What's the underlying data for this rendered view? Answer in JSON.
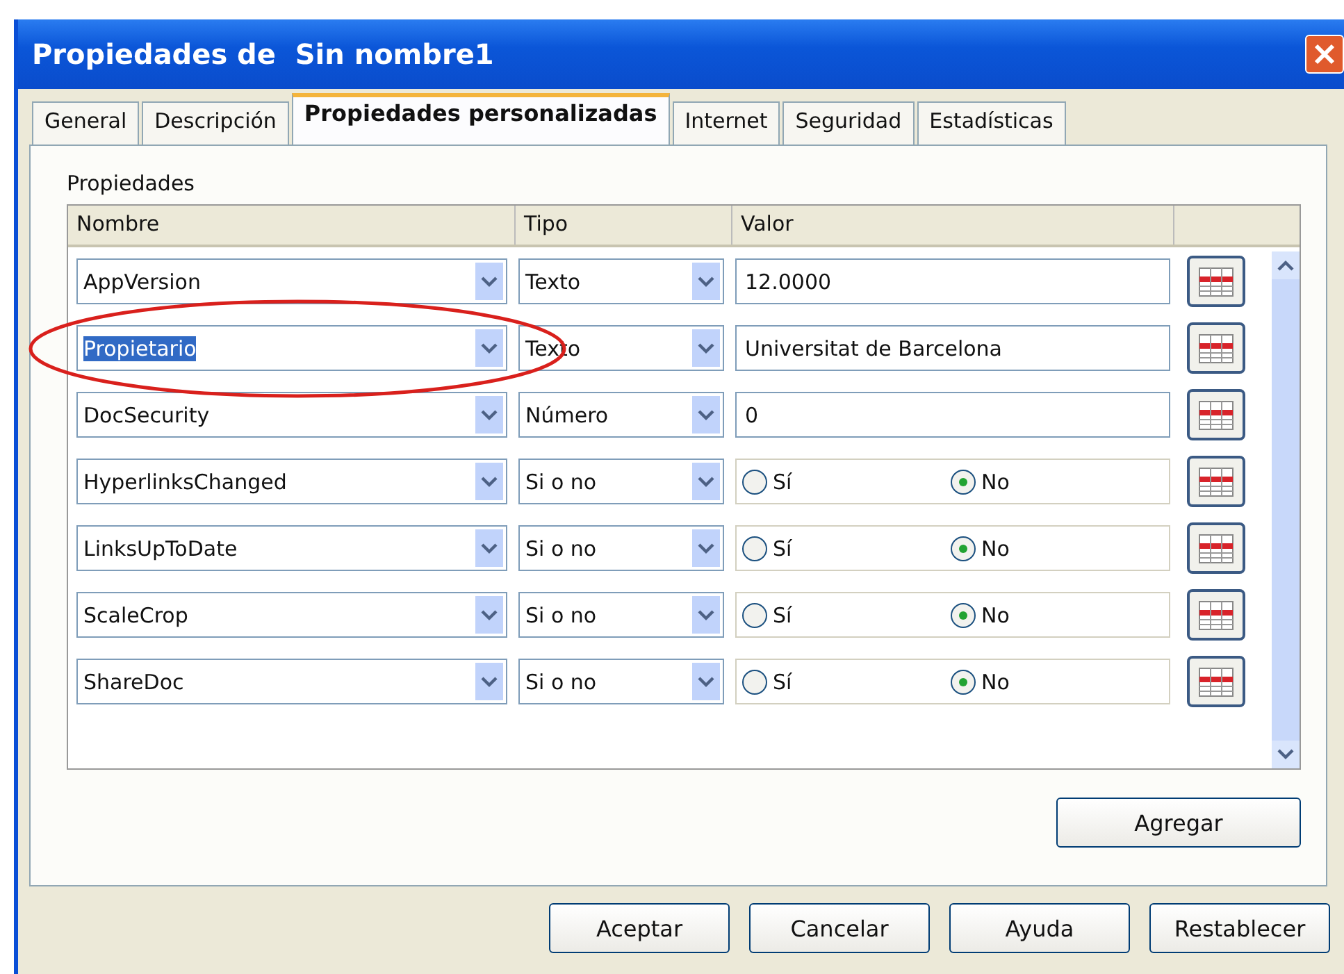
{
  "window": {
    "title": "Propiedades de  Sin nombre1"
  },
  "tabs": [
    {
      "label": "General",
      "selected": false
    },
    {
      "label": "Descripción",
      "selected": false
    },
    {
      "label": "Propiedades personalizadas",
      "selected": true
    },
    {
      "label": "Internet",
      "selected": false
    },
    {
      "label": "Seguridad",
      "selected": false
    },
    {
      "label": "Estadísticas",
      "selected": false
    }
  ],
  "section_label": "Propiedades",
  "table": {
    "columns": [
      "Nombre",
      "Tipo",
      "Valor"
    ],
    "rows": [
      {
        "kind": "text",
        "name": "AppVersion",
        "type": "Texto",
        "value": "12.0000",
        "name_selected": false,
        "circled": false
      },
      {
        "kind": "text",
        "name": "Propietario",
        "type": "Texto",
        "value": "Universitat de Barcelona",
        "name_selected": true,
        "circled": true
      },
      {
        "kind": "text",
        "name": "DocSecurity",
        "type": "Número",
        "value": "0",
        "name_selected": false,
        "circled": false
      },
      {
        "kind": "yesno",
        "name": "HyperlinksChanged",
        "type": "Si o no",
        "options": [
          {
            "label": "Sí",
            "selected": false
          },
          {
            "label": "No",
            "selected": true
          }
        ],
        "name_selected": false,
        "circled": false
      },
      {
        "kind": "yesno",
        "name": "LinksUpToDate",
        "type": "Si o no",
        "options": [
          {
            "label": "Sí",
            "selected": false
          },
          {
            "label": "No",
            "selected": true
          }
        ],
        "name_selected": false,
        "circled": false
      },
      {
        "kind": "yesno",
        "name": "ScaleCrop",
        "type": "Si o no",
        "options": [
          {
            "label": "Sí",
            "selected": false
          },
          {
            "label": "No",
            "selected": true
          }
        ],
        "name_selected": false,
        "circled": false
      },
      {
        "kind": "yesno",
        "name": "ShareDoc",
        "type": "Si o no",
        "options": [
          {
            "label": "Sí",
            "selected": false
          },
          {
            "label": "No",
            "selected": true
          }
        ],
        "name_selected": false,
        "circled": false
      }
    ]
  },
  "add_button": "Agregar",
  "buttons": [
    "Aceptar",
    "Cancelar",
    "Ayuda",
    "Restablecer"
  ]
}
